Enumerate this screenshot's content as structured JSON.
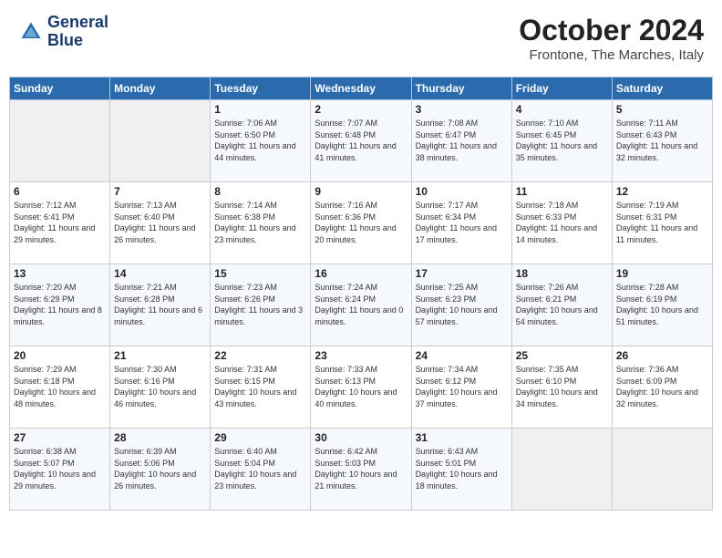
{
  "header": {
    "logo_line1": "General",
    "logo_line2": "Blue",
    "month": "October 2024",
    "location": "Frontone, The Marches, Italy"
  },
  "days_of_week": [
    "Sunday",
    "Monday",
    "Tuesday",
    "Wednesday",
    "Thursday",
    "Friday",
    "Saturday"
  ],
  "weeks": [
    [
      {
        "day": "",
        "sunrise": "",
        "sunset": "",
        "daylight": "",
        "empty": true
      },
      {
        "day": "",
        "sunrise": "",
        "sunset": "",
        "daylight": "",
        "empty": true
      },
      {
        "day": "1",
        "sunrise": "Sunrise: 7:06 AM",
        "sunset": "Sunset: 6:50 PM",
        "daylight": "Daylight: 11 hours and 44 minutes."
      },
      {
        "day": "2",
        "sunrise": "Sunrise: 7:07 AM",
        "sunset": "Sunset: 6:48 PM",
        "daylight": "Daylight: 11 hours and 41 minutes."
      },
      {
        "day": "3",
        "sunrise": "Sunrise: 7:08 AM",
        "sunset": "Sunset: 6:47 PM",
        "daylight": "Daylight: 11 hours and 38 minutes."
      },
      {
        "day": "4",
        "sunrise": "Sunrise: 7:10 AM",
        "sunset": "Sunset: 6:45 PM",
        "daylight": "Daylight: 11 hours and 35 minutes."
      },
      {
        "day": "5",
        "sunrise": "Sunrise: 7:11 AM",
        "sunset": "Sunset: 6:43 PM",
        "daylight": "Daylight: 11 hours and 32 minutes."
      }
    ],
    [
      {
        "day": "6",
        "sunrise": "Sunrise: 7:12 AM",
        "sunset": "Sunset: 6:41 PM",
        "daylight": "Daylight: 11 hours and 29 minutes."
      },
      {
        "day": "7",
        "sunrise": "Sunrise: 7:13 AM",
        "sunset": "Sunset: 6:40 PM",
        "daylight": "Daylight: 11 hours and 26 minutes."
      },
      {
        "day": "8",
        "sunrise": "Sunrise: 7:14 AM",
        "sunset": "Sunset: 6:38 PM",
        "daylight": "Daylight: 11 hours and 23 minutes."
      },
      {
        "day": "9",
        "sunrise": "Sunrise: 7:16 AM",
        "sunset": "Sunset: 6:36 PM",
        "daylight": "Daylight: 11 hours and 20 minutes."
      },
      {
        "day": "10",
        "sunrise": "Sunrise: 7:17 AM",
        "sunset": "Sunset: 6:34 PM",
        "daylight": "Daylight: 11 hours and 17 minutes."
      },
      {
        "day": "11",
        "sunrise": "Sunrise: 7:18 AM",
        "sunset": "Sunset: 6:33 PM",
        "daylight": "Daylight: 11 hours and 14 minutes."
      },
      {
        "day": "12",
        "sunrise": "Sunrise: 7:19 AM",
        "sunset": "Sunset: 6:31 PM",
        "daylight": "Daylight: 11 hours and 11 minutes."
      }
    ],
    [
      {
        "day": "13",
        "sunrise": "Sunrise: 7:20 AM",
        "sunset": "Sunset: 6:29 PM",
        "daylight": "Daylight: 11 hours and 8 minutes."
      },
      {
        "day": "14",
        "sunrise": "Sunrise: 7:21 AM",
        "sunset": "Sunset: 6:28 PM",
        "daylight": "Daylight: 11 hours and 6 minutes."
      },
      {
        "day": "15",
        "sunrise": "Sunrise: 7:23 AM",
        "sunset": "Sunset: 6:26 PM",
        "daylight": "Daylight: 11 hours and 3 minutes."
      },
      {
        "day": "16",
        "sunrise": "Sunrise: 7:24 AM",
        "sunset": "Sunset: 6:24 PM",
        "daylight": "Daylight: 11 hours and 0 minutes."
      },
      {
        "day": "17",
        "sunrise": "Sunrise: 7:25 AM",
        "sunset": "Sunset: 6:23 PM",
        "daylight": "Daylight: 10 hours and 57 minutes."
      },
      {
        "day": "18",
        "sunrise": "Sunrise: 7:26 AM",
        "sunset": "Sunset: 6:21 PM",
        "daylight": "Daylight: 10 hours and 54 minutes."
      },
      {
        "day": "19",
        "sunrise": "Sunrise: 7:28 AM",
        "sunset": "Sunset: 6:19 PM",
        "daylight": "Daylight: 10 hours and 51 minutes."
      }
    ],
    [
      {
        "day": "20",
        "sunrise": "Sunrise: 7:29 AM",
        "sunset": "Sunset: 6:18 PM",
        "daylight": "Daylight: 10 hours and 48 minutes."
      },
      {
        "day": "21",
        "sunrise": "Sunrise: 7:30 AM",
        "sunset": "Sunset: 6:16 PM",
        "daylight": "Daylight: 10 hours and 46 minutes."
      },
      {
        "day": "22",
        "sunrise": "Sunrise: 7:31 AM",
        "sunset": "Sunset: 6:15 PM",
        "daylight": "Daylight: 10 hours and 43 minutes."
      },
      {
        "day": "23",
        "sunrise": "Sunrise: 7:33 AM",
        "sunset": "Sunset: 6:13 PM",
        "daylight": "Daylight: 10 hours and 40 minutes."
      },
      {
        "day": "24",
        "sunrise": "Sunrise: 7:34 AM",
        "sunset": "Sunset: 6:12 PM",
        "daylight": "Daylight: 10 hours and 37 minutes."
      },
      {
        "day": "25",
        "sunrise": "Sunrise: 7:35 AM",
        "sunset": "Sunset: 6:10 PM",
        "daylight": "Daylight: 10 hours and 34 minutes."
      },
      {
        "day": "26",
        "sunrise": "Sunrise: 7:36 AM",
        "sunset": "Sunset: 6:09 PM",
        "daylight": "Daylight: 10 hours and 32 minutes."
      }
    ],
    [
      {
        "day": "27",
        "sunrise": "Sunrise: 6:38 AM",
        "sunset": "Sunset: 5:07 PM",
        "daylight": "Daylight: 10 hours and 29 minutes."
      },
      {
        "day": "28",
        "sunrise": "Sunrise: 6:39 AM",
        "sunset": "Sunset: 5:06 PM",
        "daylight": "Daylight: 10 hours and 26 minutes."
      },
      {
        "day": "29",
        "sunrise": "Sunrise: 6:40 AM",
        "sunset": "Sunset: 5:04 PM",
        "daylight": "Daylight: 10 hours and 23 minutes."
      },
      {
        "day": "30",
        "sunrise": "Sunrise: 6:42 AM",
        "sunset": "Sunset: 5:03 PM",
        "daylight": "Daylight: 10 hours and 21 minutes."
      },
      {
        "day": "31",
        "sunrise": "Sunrise: 6:43 AM",
        "sunset": "Sunset: 5:01 PM",
        "daylight": "Daylight: 10 hours and 18 minutes."
      },
      {
        "day": "",
        "sunrise": "",
        "sunset": "",
        "daylight": "",
        "empty": true
      },
      {
        "day": "",
        "sunrise": "",
        "sunset": "",
        "daylight": "",
        "empty": true
      }
    ]
  ]
}
